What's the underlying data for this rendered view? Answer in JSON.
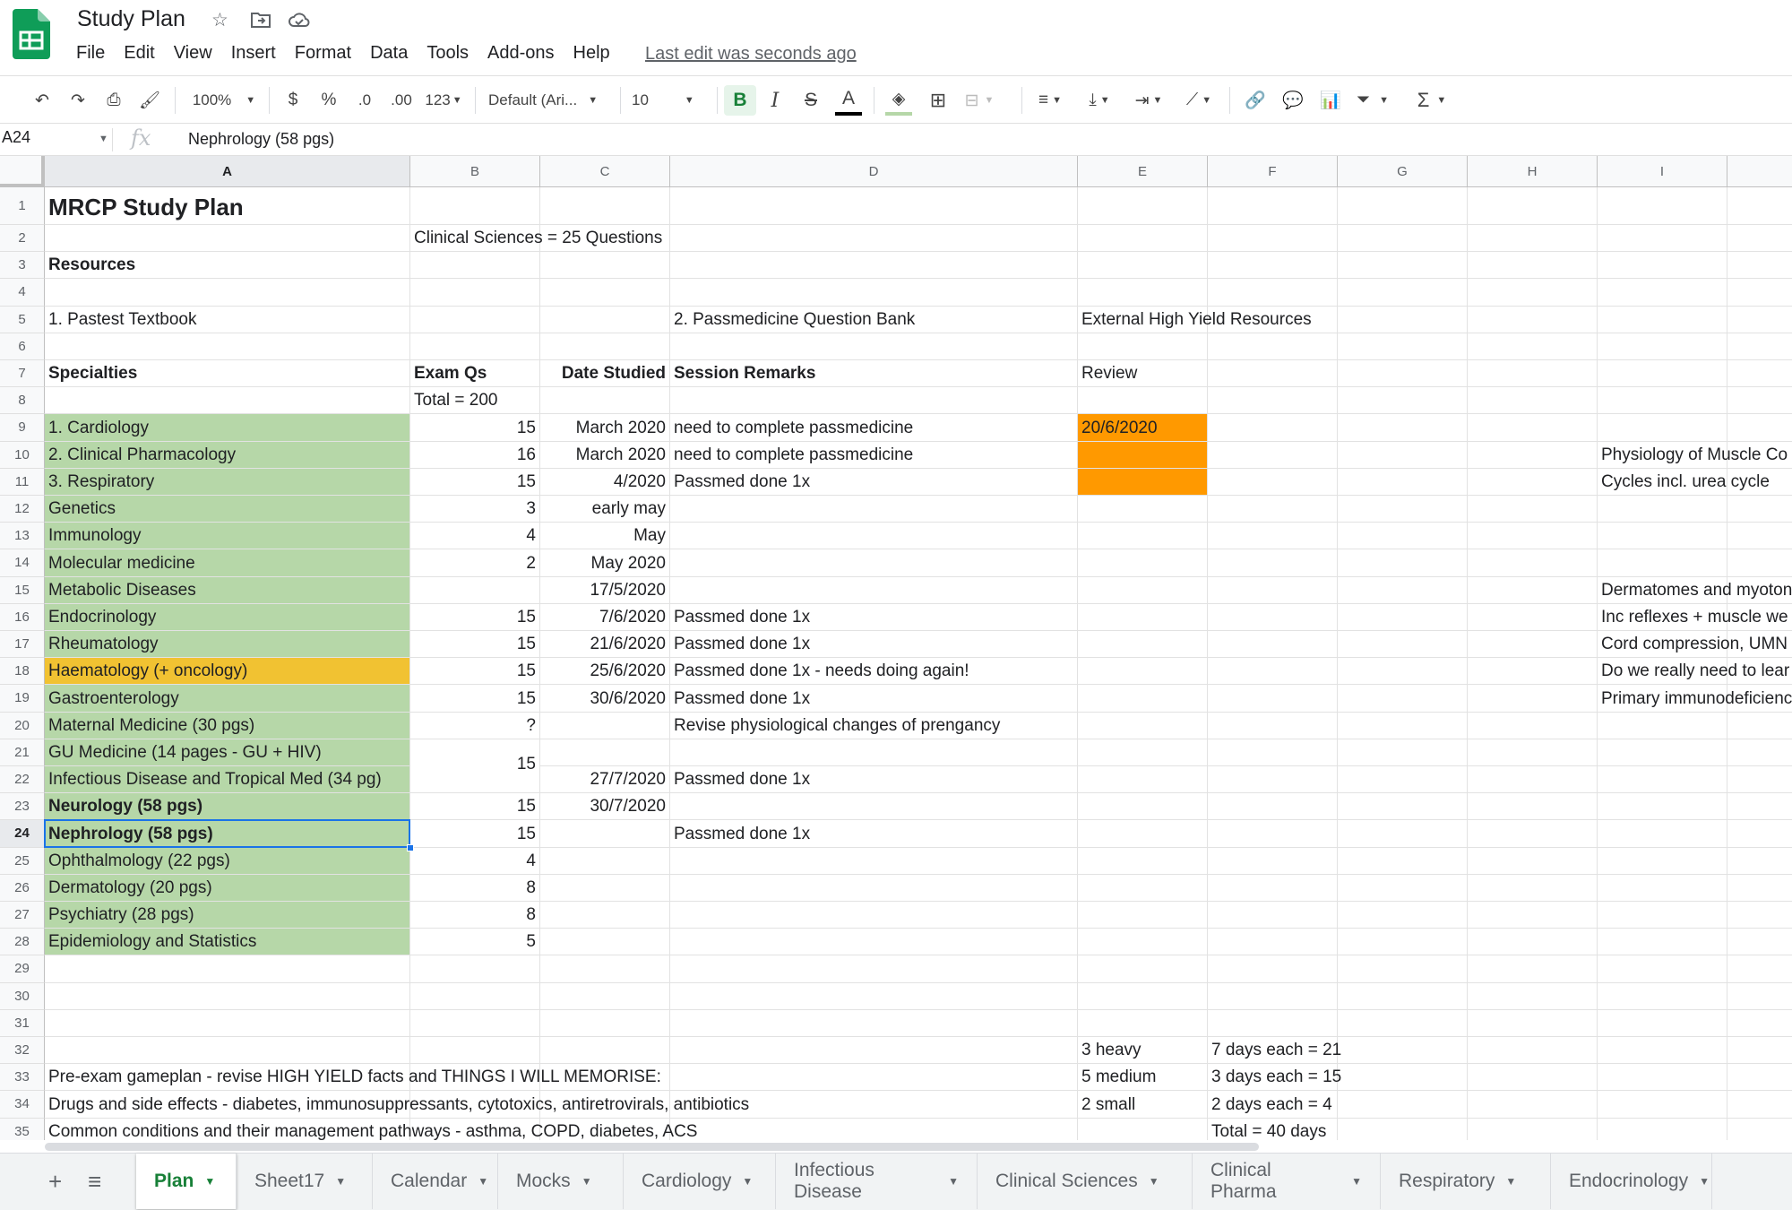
{
  "app": {
    "title": "Study Plan",
    "menu": [
      "File",
      "Edit",
      "View",
      "Insert",
      "Format",
      "Data",
      "Tools",
      "Add-ons",
      "Help"
    ],
    "last_edit": "Last edit was seconds ago"
  },
  "toolbar": {
    "zoom": "100%",
    "currency": "$",
    "percent": "%",
    "dec_decrease": ".0",
    "dec_increase": ".00",
    "more_formats": "123",
    "font": "Default (Ari...",
    "font_size": "10",
    "bold": "B",
    "italic": "I",
    "strike": "S",
    "text_color": "A"
  },
  "formula_bar": {
    "name_box": "A24",
    "fx": "fx",
    "value": "Nephrology (58 pgs)"
  },
  "columns": [
    "A",
    "B",
    "C",
    "D",
    "E",
    "F",
    "G",
    "H",
    "I"
  ],
  "selected_column": "A",
  "selected_row": "24",
  "rows": [
    "1",
    "2",
    "3",
    "4",
    "5",
    "6",
    "7",
    "8",
    "9",
    "10",
    "11",
    "12",
    "13",
    "14",
    "15",
    "16",
    "17",
    "18",
    "19",
    "20",
    "21",
    "22",
    "23",
    "24",
    "25",
    "26",
    "27",
    "28",
    "29",
    "30",
    "31",
    "32",
    "33",
    "34",
    "35"
  ],
  "cells": {
    "A1": "MRCP Study Plan",
    "B2": "Clinical Sciences = 25 Questions",
    "A3": "Resources",
    "A5": "1. Pastest Textbook",
    "D5": "2. Passmedicine Question Bank",
    "E5": "External High Yield Resources",
    "A7": "Specialties",
    "B7": "Exam Qs",
    "C7": "Date Studied",
    "D7": "Session Remarks",
    "E7": "Review",
    "B8": "Total = 200",
    "A9": "1. Cardiology",
    "B9": "15",
    "C9": "March 2020",
    "D9": "need to complete passmedicine",
    "E9": "20/6/2020",
    "A10": "2. Clinical Pharmacology",
    "B10": "16",
    "C10": "March 2020",
    "D10": "need to complete passmedicine",
    "I10": "Physiology of Muscle Co",
    "A11": "3. Respiratory",
    "B11": "15",
    "C11": "4/2020",
    "D11": "Passmed done 1x",
    "I11": "Cycles incl. urea cycle",
    "A12": "Genetics",
    "B12": "3",
    "C12": "early may",
    "A13": "Immunology",
    "B13": "4",
    "C13": "May",
    "A14": "Molecular medicine",
    "B14": "2",
    "C14": "May 2020",
    "A15": "Metabolic Diseases",
    "C15": "17/5/2020",
    "I15": "Dermatomes and myoton",
    "A16": "Endocrinology",
    "B16": "15",
    "C16": "7/6/2020",
    "D16": "Passmed done 1x",
    "I16": "Inc reflexes + muscle we",
    "A17": "Rheumatology",
    "B17": "15",
    "C17": "21/6/2020",
    "D17": "Passmed done 1x",
    "I17": "Cord compression, UMN",
    "A18": "Haematology (+ oncology)",
    "B18": "15",
    "C18": "25/6/2020",
    "D18": "Passmed done 1x - needs doing again!",
    "I18": "Do we really need to lear",
    "A19": "Gastroenterology",
    "B19": "15",
    "C19": "30/6/2020",
    "D19": "Passmed done 1x",
    "I19": "Primary immunodeficienc",
    "A20": "Maternal Medicine (30 pgs)",
    "B20": "?",
    "D20": "Revise physiological changes of prengancy",
    "A21": "GU Medicine (14 pages - GU + HIV)",
    "B21": "15",
    "A22": "Infectious Disease and Tropical Med (34 pg)",
    "C22": "27/7/2020",
    "D22": "Passmed done 1x",
    "A23": "Neurology (58 pgs)",
    "B23": "15",
    "C23": "30/7/2020",
    "A24": "Nephrology (58 pgs)",
    "B24": "15",
    "D24": "Passmed done 1x",
    "A25": "Ophthalmology (22 pgs)",
    "B25": "4",
    "A26": "Dermatology (20 pgs)",
    "B26": "8",
    "A27": "Psychiatry (28 pgs)",
    "B27": "8",
    "A28": "Epidemiology and Statistics",
    "B28": "5",
    "E32": "3 heavy",
    "F32": "7 days each = 21",
    "A33": "Pre-exam gameplan - revise HIGH YIELD facts and THINGS I WILL MEMORISE:",
    "E33": "5 medium",
    "F33": "3 days each = 15",
    "A34": "Drugs and side effects - diabetes, immunosuppressants, cytotoxics, antiretrovirals, antibiotics",
    "E34": "2 small",
    "F34": "2 days each = 4",
    "A35": "Common conditions and their management pathways - asthma, COPD, diabetes, ACS",
    "F35": "Total = 40 days"
  },
  "fill_colors": {
    "green": "#b6d7a8",
    "gold": "#f1c232",
    "orange": "#ff9900",
    "accent": "#188038"
  },
  "sheet_tabs": [
    "Plan",
    "Sheet17",
    "Calendar",
    "Mocks",
    "Cardiology",
    "Infectious Disease",
    "Clinical Sciences",
    "Clinical Pharma",
    "Respiratory",
    "Endocrinology"
  ],
  "active_tab": "Plan"
}
